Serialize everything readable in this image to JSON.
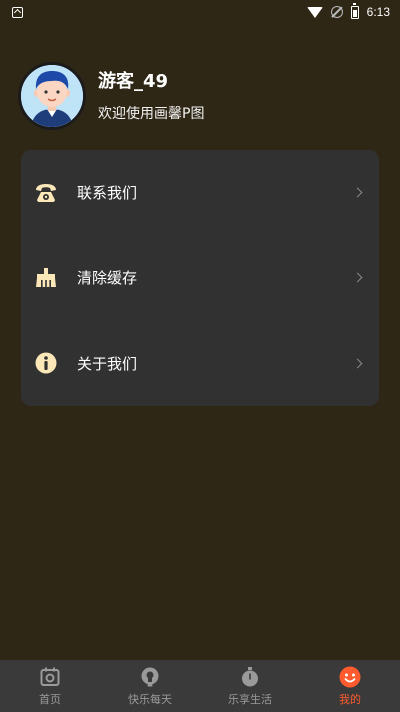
{
  "status_bar": {
    "time": "6:13",
    "icons": [
      "notification-icon",
      "wifi-icon",
      "no-signal-icon",
      "battery-icon"
    ]
  },
  "profile": {
    "username": "游客_49",
    "welcome": "欢迎使用画馨P图",
    "avatar_icon": "avatar-boy-icon"
  },
  "menu": {
    "items": [
      {
        "label": "联系我们",
        "icon": "telephone-icon"
      },
      {
        "label": "清除缓存",
        "icon": "broom-icon"
      },
      {
        "label": "关于我们",
        "icon": "info-icon"
      }
    ]
  },
  "nav": {
    "items": [
      {
        "label": "首页",
        "icon": "camera-frame-icon",
        "active": false
      },
      {
        "label": "快乐每天",
        "icon": "lightbulb-icon",
        "active": false
      },
      {
        "label": "乐享生活",
        "icon": "stopwatch-icon",
        "active": false
      },
      {
        "label": "我的",
        "icon": "smiley-icon",
        "active": true
      }
    ]
  },
  "colors": {
    "background": "#2f2716",
    "card": "#313131",
    "icon_cream": "#fbe7b8",
    "active": "#ff5b2e",
    "nav_bg": "#3a3a3a",
    "nav_inactive": "#9a9a9a"
  }
}
